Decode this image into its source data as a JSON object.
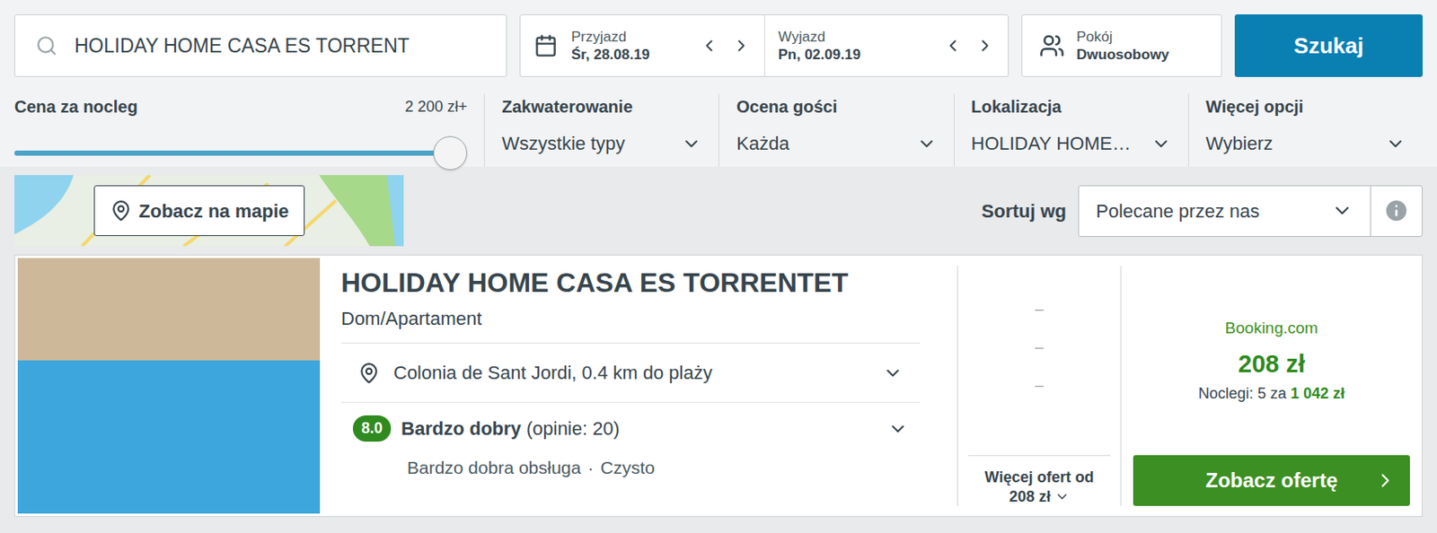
{
  "search": {
    "value": "HOLIDAY HOME CASA ES TORRENT"
  },
  "dates": [
    {
      "label": "Przyjazd",
      "value": "Śr, 28.08.19"
    },
    {
      "label": "Wyjazd",
      "value": "Pn, 02.09.19"
    }
  ],
  "room": {
    "label": "Pokój",
    "value": "Dwuosobowy"
  },
  "search_button": "Szukaj",
  "price_filter": {
    "label": "Cena za nocleg",
    "reading": "2 200 zł+",
    "level": 1
  },
  "filters": [
    {
      "label": "Zakwaterowanie",
      "value": "Wszystkie typy"
    },
    {
      "label": "Ocena gości",
      "value": "Każda"
    },
    {
      "label": "Lokalizacja",
      "value": "HOLIDAY HOME…"
    },
    {
      "label": "Więcej opcji",
      "value": "Wybierz"
    }
  ],
  "map_button": "Zobacz na mapie",
  "sort": {
    "label": "Sortuj wg",
    "value": "Polecane przez nas"
  },
  "hotel": {
    "name": "HOLIDAY HOME CASA ES TORRENTET",
    "type": "Dom/Apartament",
    "location": "Colonia de Sant Jordi, 0.4 km do plaży",
    "rating": "8.0",
    "rating_label": "Bardzo dobry",
    "reviews": "(opinie: 20)",
    "tags": [
      "Bardzo dobra obsługa",
      "Czysto"
    ],
    "tag_separator": "·",
    "other_prices": [
      "–",
      "–",
      "–"
    ],
    "more_offers": "Więcej ofert od",
    "more_offers_price": "208 zł",
    "provider": "Booking.com",
    "price": "208 zł",
    "nights_label": "Noclegi: 5 za",
    "total": "1 042 zł",
    "cta": "Zobacz ofertę"
  }
}
